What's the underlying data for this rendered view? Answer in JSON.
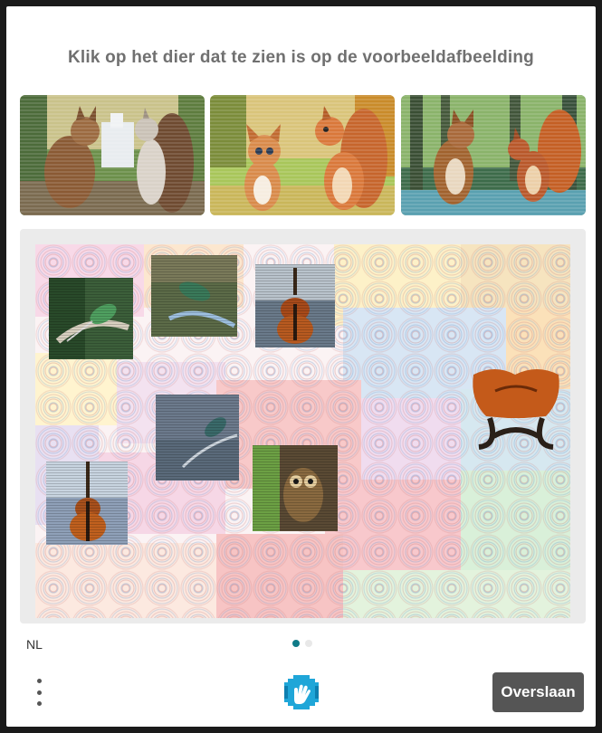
{
  "challenge": {
    "prompt": "Klik op het dier dat te zien is op de voorbeeldafbeelding"
  },
  "examples": [
    {
      "subject": "cat and squirrel"
    },
    {
      "subject": "cartoon cat and squirrel"
    },
    {
      "subject": "cat and squirrel in forest"
    }
  ],
  "canvas": {
    "items": [
      "hummingbird",
      "hummingbird",
      "violin",
      "hummingbird",
      "violin",
      "owl",
      "violin"
    ]
  },
  "footer": {
    "language": "NL",
    "skip_label": "Overslaan",
    "page_count": 2,
    "active_page": 1
  },
  "colors": {
    "accent": "#0f7b88",
    "button_bg": "#555555",
    "prompt_text": "#707070",
    "logo_blue": "#1fa6d8"
  }
}
